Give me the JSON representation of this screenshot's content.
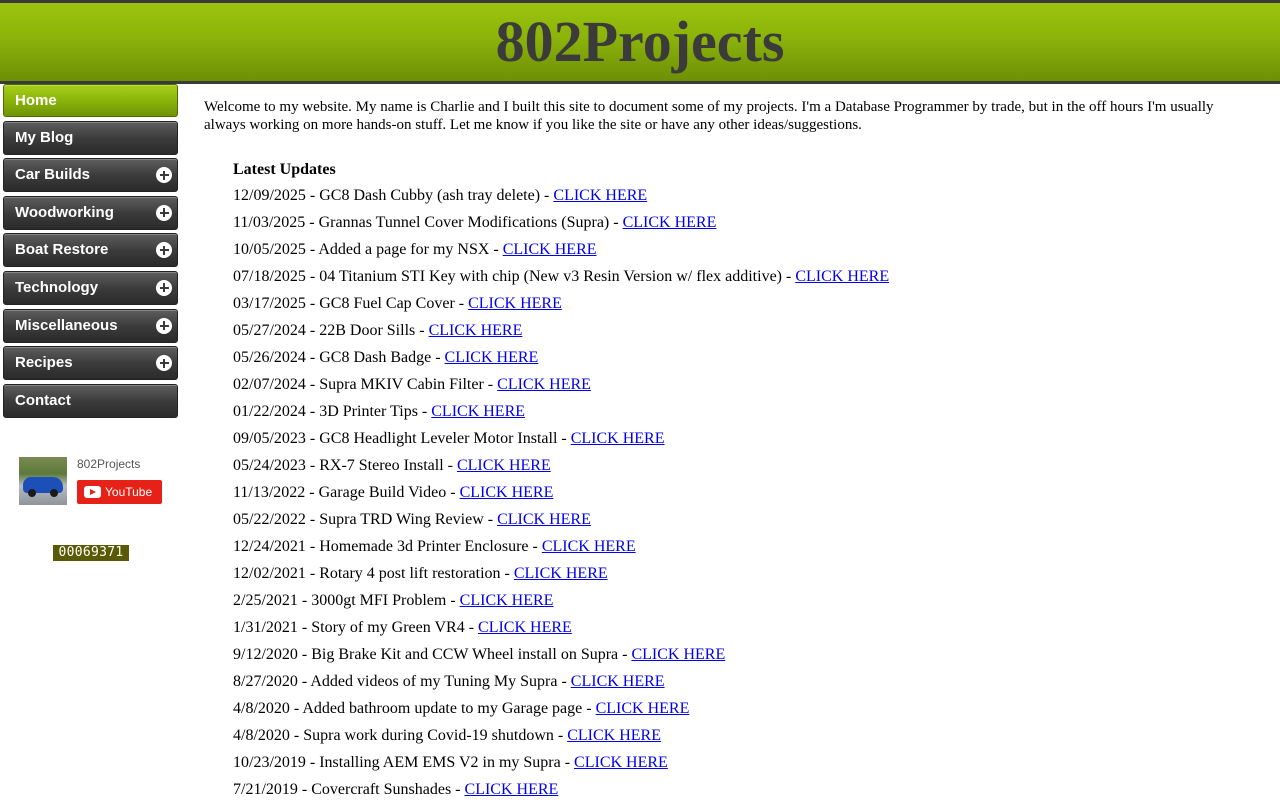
{
  "header": {
    "title": "802Projects"
  },
  "nav": [
    {
      "label": "Home",
      "active": true,
      "expandable": false
    },
    {
      "label": "My Blog",
      "active": false,
      "expandable": false
    },
    {
      "label": "Car Builds",
      "active": false,
      "expandable": true
    },
    {
      "label": "Woodworking",
      "active": false,
      "expandable": true
    },
    {
      "label": "Boat Restore",
      "active": false,
      "expandable": true
    },
    {
      "label": "Technology",
      "active": false,
      "expandable": true
    },
    {
      "label": "Miscellaneous",
      "active": false,
      "expandable": true
    },
    {
      "label": "Recipes",
      "active": false,
      "expandable": true
    },
    {
      "label": "Contact",
      "active": false,
      "expandable": false
    }
  ],
  "youtube": {
    "channel": "802Projects",
    "button_label": "YouTube"
  },
  "hit_counter": "00069371",
  "main": {
    "intro": "Welcome to my website. My name is Charlie and I built this site to document some of my projects. I'm a Database Programmer by trade, but in the off hours I'm usually always working on more hands-on stuff. Let me know if you like the site or have any other ideas/suggestions.",
    "updates_heading": "Latest Updates",
    "link_label": "CLICK HERE",
    "updates": [
      "12/09/2025 - GC8 Dash Cubby (ash tray delete) - ",
      "11/03/2025 - Grannas Tunnel Cover Modifications (Supra) - ",
      "10/05/2025 - Added a page for my NSX - ",
      "07/18/2025 - 04 Titanium STI Key with chip (New v3 Resin Version w/ flex additive) - ",
      "03/17/2025 - GC8 Fuel Cap Cover - ",
      "05/27/2024 - 22B Door Sills - ",
      "05/26/2024 - GC8 Dash Badge - ",
      "02/07/2024 - Supra MKIV Cabin Filter - ",
      "01/22/2024 - 3D Printer Tips - ",
      "09/05/2023 - GC8 Headlight Leveler Motor Install - ",
      "05/24/2023 - RX-7 Stereo Install - ",
      "11/13/2022 - Garage Build Video - ",
      "05/22/2022 - Supra TRD Wing Review - ",
      "12/24/2021 - Homemade 3d Printer Enclosure - ",
      "12/02/2021 - Rotary 4 post lift restoration - ",
      "2/25/2021 - 3000gt MFI Problem - ",
      "1/31/2021 - Story of my Green VR4 - ",
      "9/12/2020 - Big Brake Kit and CCW Wheel install on Supra - ",
      "8/27/2020 - Added videos of my Tuning My Supra - ",
      "4/8/2020 - Added bathroom update to my Garage page - ",
      "4/8/2020 - Supra work during Covid-19 shutdown - ",
      "10/23/2019 - Installing AEM EMS V2 in my Supra - ",
      "7/21/2019 - Covercraft Sunshades - "
    ]
  }
}
